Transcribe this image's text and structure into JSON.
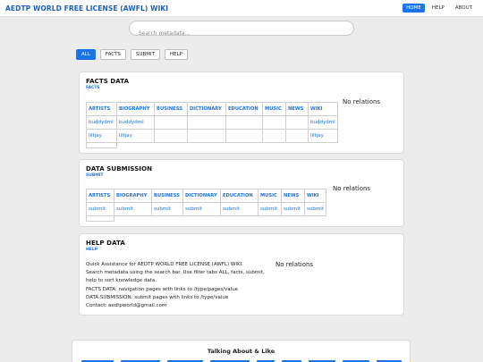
{
  "header": {
    "brand": "AEDTP WORLD FREE LICENSE (AWFL) WIKI",
    "nav": [
      "HOME",
      "HELP",
      "ABOUT"
    ]
  },
  "search": {
    "placeholder": "Search metadata..."
  },
  "filters": [
    "ALL",
    "FACTS",
    "SUBMIT",
    "HELP"
  ],
  "facts": {
    "title": "FACTS DATA",
    "sub": "FACTS",
    "columns": [
      "ARTISTS",
      "BIOGRAPHY",
      "BUSINESS",
      "DICTIONARY",
      "EDUCATION",
      "MUSIC",
      "NEWS",
      "WIKI"
    ],
    "rows": [
      [
        "buddydml",
        "buddydml",
        "",
        "",
        "",
        "",
        "",
        "buddydml"
      ],
      [
        "liltjay",
        "liltjay",
        "",
        "",
        "",
        "",
        "",
        "liltjay"
      ]
    ],
    "relations": "No relations"
  },
  "submission": {
    "title": "DATA SUBMISSION",
    "sub": "SUBMIT",
    "columns": [
      "ARTISTS",
      "BIOGRAPHY",
      "BUSINESS",
      "DICTIONARY",
      "EDUCATION",
      "MUSIC",
      "NEWS",
      "WIKI"
    ],
    "rows": [
      [
        "submit",
        "submit",
        "submit",
        "submit",
        "submit",
        "submit",
        "submit",
        "submit"
      ]
    ],
    "relations": "No relations"
  },
  "help": {
    "title": "HELP DATA",
    "sub": "HELP",
    "lines": [
      "Quick Assistance for AEDTP WORLD FREE LICENSE (AWFL) WIKI.",
      "Search metadata using the search bar. Use filter tabs ALL, facts, submit,",
      "help to sort knowledge data.",
      "FACTS DATA: navigation pages with links to /type/pages/value",
      "DATA SUBMISSION: submit pages with links to /type/value",
      "Contact: aedtpworld@gmail.com"
    ],
    "relations": "No relations"
  },
  "footer": {
    "title": "Talking About & Like"
  },
  "colors": {
    "accent": "#1a73e8",
    "brand": "#1b5fbf",
    "background": "#ececec"
  }
}
